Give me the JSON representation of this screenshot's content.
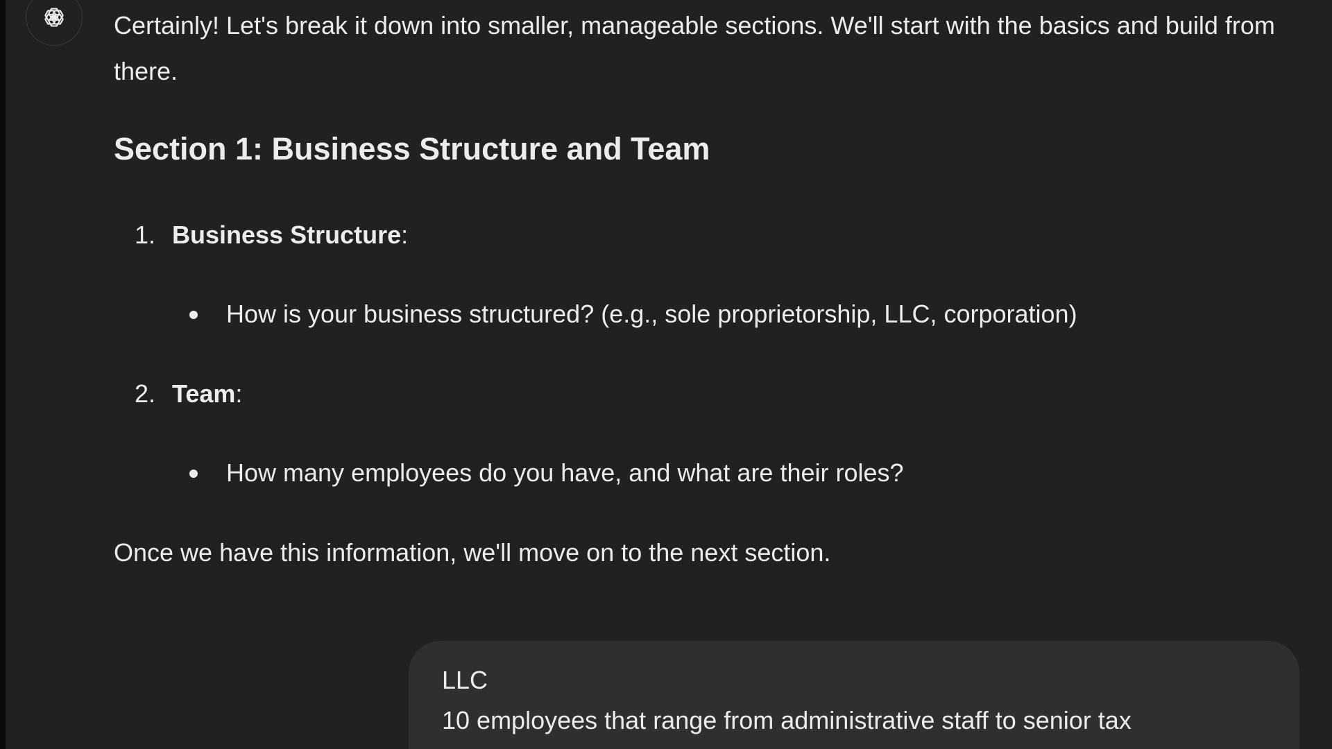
{
  "assistant_message": {
    "intro": "Certainly! Let's break it down into smaller, manageable sections. We'll start with the basics and build from there.",
    "section_heading": "Section 1: Business Structure and Team",
    "items": [
      {
        "number": "1.",
        "label": "Business Structure",
        "colon": ":",
        "bullet": "How is your business structured? (e.g., sole proprietorship, LLC, corporation)"
      },
      {
        "number": "2.",
        "label": "Team",
        "colon": ":",
        "bullet": "How many employees do you have, and what are their roles?"
      }
    ],
    "closing": "Once we have this information, we'll move on to the next section."
  },
  "user_message": {
    "line1": "LLC",
    "line2": "10 employees that range from administrative staff to senior tax"
  },
  "avatar": {
    "icon": "openai-logo-icon"
  },
  "colors": {
    "chat_background": "#212121",
    "user_bubble": "#2f2f2f",
    "text": "#ececec"
  }
}
